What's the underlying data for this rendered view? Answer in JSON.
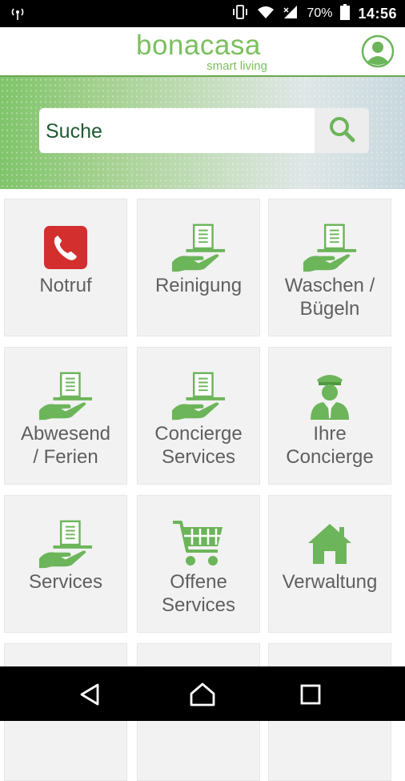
{
  "status_bar": {
    "battery_percent": "70%",
    "time": "14:56",
    "icons": [
      "radio-signal-icon",
      "vibrate-icon",
      "wifi-icon",
      "cell-signal-icon",
      "battery-icon"
    ]
  },
  "header": {
    "brand_name": "bonacasa",
    "brand_tagline": "smart living",
    "profile_icon": "profile-icon"
  },
  "search": {
    "placeholder": "Suche",
    "button_icon": "search-icon"
  },
  "colors": {
    "brand_green": "#7bbf5f",
    "icon_green": "#6cb55a",
    "alert_red": "#d32f2f",
    "tile_bg": "#f2f2f2",
    "label_grey": "#5f5f5f"
  },
  "tiles": [
    {
      "label_line1": "Notruf",
      "label_line2": "",
      "icon": "phone-icon"
    },
    {
      "label_line1": "Reinigung",
      "label_line2": "",
      "icon": "hand-document-icon"
    },
    {
      "label_line1": "Waschen /",
      "label_line2": "Bügeln",
      "icon": "hand-document-icon"
    },
    {
      "label_line1": "Abwesend",
      "label_line2": "/ Ferien",
      "icon": "hand-document-icon"
    },
    {
      "label_line1": "Concierge",
      "label_line2": "Services",
      "icon": "hand-document-icon"
    },
    {
      "label_line1": "Ihre",
      "label_line2": "Concierge",
      "icon": "concierge-icon"
    },
    {
      "label_line1": "Services",
      "label_line2": "",
      "icon": "hand-document-icon"
    },
    {
      "label_line1": "Offene",
      "label_line2": "Services",
      "icon": "shopping-cart-icon"
    },
    {
      "label_line1": "Verwaltung",
      "label_line2": "",
      "icon": "home-icon"
    }
  ],
  "nav": {
    "back_icon": "back-triangle-icon",
    "home_icon": "home-circle-icon",
    "recents_icon": "recents-square-icon"
  }
}
